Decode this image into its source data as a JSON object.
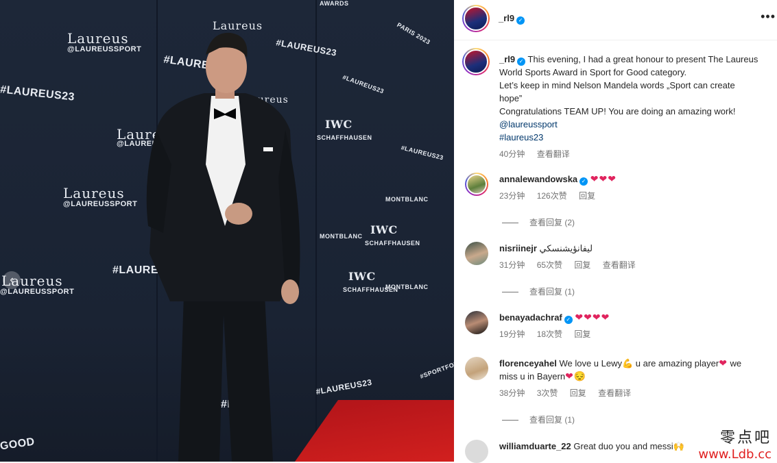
{
  "photo": {
    "wall_text": {
      "laureus": "Laureus",
      "handle": "@LAUREUSSPORT",
      "hashtag": "#LAUREUS23",
      "paris": "PARIS 2023",
      "awards": "AWARDS",
      "iwc": "IWC",
      "schaffhausen": "SCHAFFHAUSEN",
      "montblanc": "MONTBLANC",
      "sportforgood": "#SPORTFORGOOD",
      "good": "GOOD",
      "hash_laur": "#LAUR"
    },
    "carousel_prev_icon": "chevron-left-icon"
  },
  "post": {
    "author": "_rl9",
    "more_icon": "more-horizontal-icon",
    "caption": {
      "author": "_rl9",
      "line1": "This evening, I had a great honour to present The Laureus",
      "line2": "World Sports Award in Sport for Good category.",
      "line3": "Let’s keep in mind Nelson Mandela words „Sport can create",
      "line4": "hope”",
      "line5": "Congratulations TEAM UP! You are doing an amazing work!",
      "mention": "@laureussport",
      "hashtag": "#laureus23",
      "time": "40分钟",
      "translate": "查看翻译"
    }
  },
  "comments": [
    {
      "user": "annalewandowska",
      "verified": true,
      "text": "",
      "hearts": "❤❤❤",
      "time": "23分钟",
      "likes": "126次赞",
      "reply": "回复",
      "translate": "",
      "view_replies": "查看回复 (2)"
    },
    {
      "user": "nisriinejr",
      "verified": false,
      "text": "ليفانؤيشنسكي",
      "hearts": "",
      "time": "31分钟",
      "likes": "65次赞",
      "reply": "回复",
      "translate": "查看翻译",
      "view_replies": "查看回复 (1)"
    },
    {
      "user": "benayadachraf",
      "verified": true,
      "text": "",
      "hearts": "❤❤❤❤",
      "time": "19分钟",
      "likes": "18次赞",
      "reply": "回复",
      "translate": "",
      "view_replies": ""
    },
    {
      "user": "florenceyahel",
      "verified": false,
      "text1": "We love u Lewy",
      "emoji1": "💪",
      "text2": " u are amazing player",
      "emoji2": "❤",
      "text3": " we",
      "text4": "miss u in Bayern",
      "emoji3": "❤😔",
      "time": "38分钟",
      "likes": "3次赞",
      "reply": "回复",
      "translate": "查看翻译",
      "view_replies": "查看回复 (1)"
    },
    {
      "user": "williamduarte_22",
      "verified": false,
      "text": "Great duo you and messi",
      "emoji": "🙌",
      "time": "",
      "likes": "",
      "reply": "",
      "translate": "",
      "view_replies": ""
    }
  ],
  "watermark": {
    "line1": "零点吧",
    "line2": "www.Ldb.cc"
  },
  "colors": {
    "link": "#00376b",
    "verified": "#0095f6",
    "heart": "#e0245e",
    "meta": "#737373"
  }
}
